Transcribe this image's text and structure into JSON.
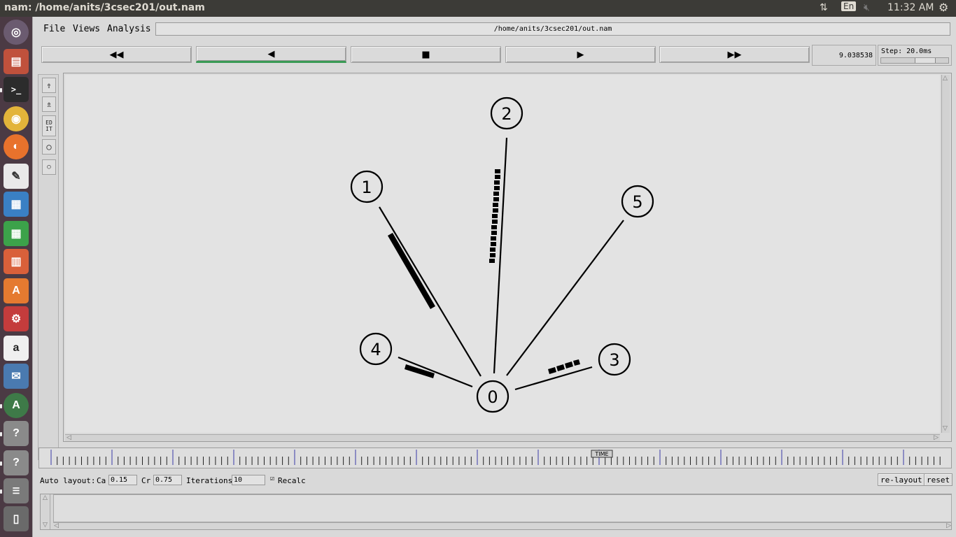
{
  "window": {
    "title": "nam: /home/anits/3csec201/out.nam"
  },
  "indicators": {
    "lang": "En",
    "clock": "11:32 AM"
  },
  "menu": {
    "file": "File",
    "views": "Views",
    "analysis": "Analysis"
  },
  "filepath": "/home/anits/3csec201/out.nam",
  "controls": {
    "rewind": "◀◀",
    "back": "◀",
    "stop": "■",
    "play": "▶",
    "fastforward": "▶▶",
    "time": "9.038538",
    "step": "Step: 20.0ms"
  },
  "toolbar": {
    "edit": "ED IT"
  },
  "nodes": [
    {
      "id": "0",
      "label": "0"
    },
    {
      "id": "1",
      "label": "1"
    },
    {
      "id": "2",
      "label": "2"
    },
    {
      "id": "3",
      "label": "3"
    },
    {
      "id": "4",
      "label": "4"
    },
    {
      "id": "5",
      "label": "5"
    }
  ],
  "timeline": {
    "marker": "TIME"
  },
  "autolayout": {
    "label": "Auto layout:",
    "ca_label": "Ca",
    "ca_value": "0.15",
    "cr_label": "Cr",
    "cr_value": "0.75",
    "iter_label": "Iterations",
    "iter_value": "10",
    "recalc_label": "Recalc",
    "relayout": "re-layout",
    "reset": "reset"
  },
  "colors": {
    "accent": "#3a9a55",
    "topbar": "#3c3b37",
    "launcher": "#4b3a44"
  }
}
